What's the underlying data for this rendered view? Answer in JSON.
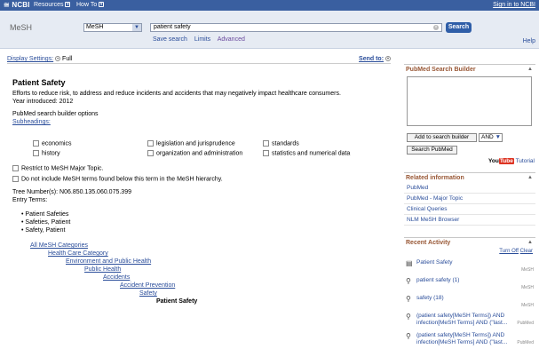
{
  "topnav": {
    "logo": "NCBI",
    "resources": "Resources",
    "howto": "How To",
    "signin": "Sign in to NCBI"
  },
  "search": {
    "db_title": "MeSH",
    "db_selected": "MeSH",
    "query": "patient safety",
    "button": "Search",
    "save": "Save search",
    "limits": "Limits",
    "advanced": "Advanced",
    "help": "Help"
  },
  "display": {
    "settings_label": "Display Settings:",
    "settings_value": "Full",
    "send_to": "Send to:"
  },
  "record": {
    "title": "Patient Safety",
    "definition": "Efforts to reduce risk, to address and reduce incidents and accidents that may negatively impact healthcare consumers.",
    "introduced": "Year introduced: 2012",
    "builder_opts": "PubMed search builder options",
    "subheadings": "Subheadings:",
    "subheading_items": [
      "economics",
      "history",
      "legislation and jurisprudence",
      "organization and administration",
      "standards",
      "statistics and numerical data"
    ],
    "restrict": "Restrict to MeSH Major Topic.",
    "noexplode": "Do not include MeSH terms found below this term in the MeSH hierarchy.",
    "tree_number": "Tree Number(s): N06.850.135.060.075.399",
    "entry_terms_label": "Entry Terms:",
    "entry_terms": [
      "Patient Safeties",
      "Safeties, Patient",
      "Safety, Patient"
    ],
    "hierarchy": [
      "All MeSH Categories",
      "Health Care Category",
      "Environment and Public Health",
      "Public Health",
      "Accidents",
      "Accident Prevention",
      "Safety",
      "Patient Safety"
    ]
  },
  "builder": {
    "title": "PubMed Search Builder",
    "add_button": "Add to search builder",
    "operator": "AND",
    "search_button": "Search PubMed",
    "you": "You",
    "tube": "Tube",
    "tutorial": "Tutorial"
  },
  "related": {
    "title": "Related information",
    "items": [
      "PubMed",
      "PubMed - Major Topic",
      "Clinical Queries",
      "NLM MeSH Browser"
    ]
  },
  "recent": {
    "title": "Recent Activity",
    "turn_off": "Turn Off",
    "clear": "Clear",
    "items": [
      {
        "text": "Patient Safety",
        "db": "MeSH"
      },
      {
        "text": "patient safety (1)",
        "db": "MeSH"
      },
      {
        "text": "safety (18)",
        "db": "MeSH"
      },
      {
        "text": "(patient safety[MeSH Terms]) AND infection[MeSH Terms] AND (\"last...",
        "db": "PubMed"
      },
      {
        "text": "(patient safety[MeSH Terms]) AND infection[MeSH Terms] AND (\"last...",
        "db": "PubMed"
      }
    ]
  }
}
